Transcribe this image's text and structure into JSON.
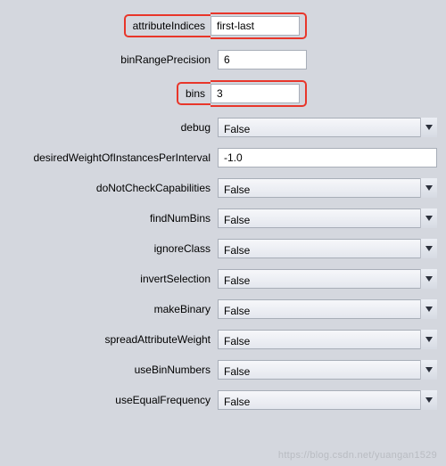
{
  "options": {
    "attributeIndices": {
      "label": "attributeIndices",
      "value": "first-last",
      "type": "text",
      "highlight": true,
      "narrow": true
    },
    "binRangePrecision": {
      "label": "binRangePrecision",
      "value": "6",
      "type": "text",
      "narrow": true
    },
    "bins": {
      "label": "bins",
      "value": "3",
      "type": "text",
      "highlight": true,
      "narrow": true
    },
    "debug": {
      "label": "debug",
      "value": "False",
      "type": "select"
    },
    "desiredWeightOfInstancesPerInterval": {
      "label": "desiredWeightOfInstancesPerInterval",
      "value": "-1.0",
      "type": "text"
    },
    "doNotCheckCapabilities": {
      "label": "doNotCheckCapabilities",
      "value": "False",
      "type": "select"
    },
    "findNumBins": {
      "label": "findNumBins",
      "value": "False",
      "type": "select"
    },
    "ignoreClass": {
      "label": "ignoreClass",
      "value": "False",
      "type": "select"
    },
    "invertSelection": {
      "label": "invertSelection",
      "value": "False",
      "type": "select"
    },
    "makeBinary": {
      "label": "makeBinary",
      "value": "False",
      "type": "select"
    },
    "spreadAttributeWeight": {
      "label": "spreadAttributeWeight",
      "value": "False",
      "type": "select"
    },
    "useBinNumbers": {
      "label": "useBinNumbers",
      "value": "False",
      "type": "select"
    },
    "useEqualFrequency": {
      "label": "useEqualFrequency",
      "value": "False",
      "type": "select"
    }
  },
  "order": [
    "attributeIndices",
    "binRangePrecision",
    "bins",
    "debug",
    "desiredWeightOfInstancesPerInterval",
    "doNotCheckCapabilities",
    "findNumBins",
    "ignoreClass",
    "invertSelection",
    "makeBinary",
    "spreadAttributeWeight",
    "useBinNumbers",
    "useEqualFrequency"
  ],
  "watermark": "https://blog.csdn.net/yuangan1529"
}
